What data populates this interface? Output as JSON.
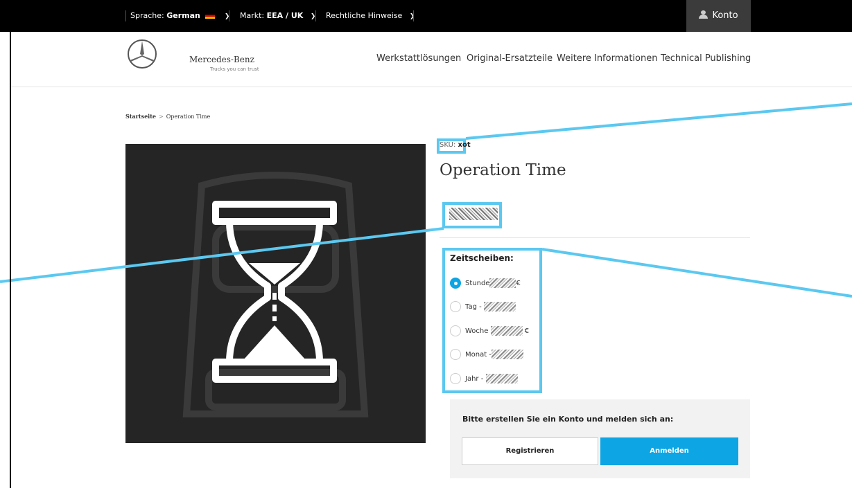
{
  "topbar": {
    "language_label": "Sprache:",
    "language_value": "German",
    "market_label": "Markt:",
    "market_value": "EEA / UK",
    "legal_label": "Rechtliche Hinweise",
    "account_label": "Konto"
  },
  "header": {
    "brand": "Mercedes-Benz",
    "tagline": "Trucks you can trust",
    "nav": [
      "Werkstattlösungen",
      "Original-Ersatzteile",
      "Weitere Informationen",
      "Technical Publishing"
    ]
  },
  "breadcrumb": {
    "home": "Startseite",
    "current": "Operation Time"
  },
  "product": {
    "sku_label": "SKU:",
    "sku_value": "xot",
    "title": "Operation Time",
    "timeslice_label": "Zeitscheiben:",
    "options": [
      {
        "label": "Stunde",
        "suffix": "€",
        "selected": true
      },
      {
        "label": "Tag -",
        "suffix": "",
        "selected": false
      },
      {
        "label": "Woche",
        "suffix": "€",
        "selected": false
      },
      {
        "label": "Monat -",
        "suffix": "",
        "selected": false
      },
      {
        "label": "Jahr -",
        "suffix": "",
        "selected": false
      }
    ]
  },
  "login": {
    "prompt": "Bitte erstellen Sie ein Konto und melden sich an:",
    "register_label": "Registrieren",
    "login_label": "Anmelden"
  },
  "colors": {
    "accent": "#0da5e3",
    "highlight": "#5bc8f0",
    "topbar": "#000000",
    "image_bg": "#252525"
  }
}
